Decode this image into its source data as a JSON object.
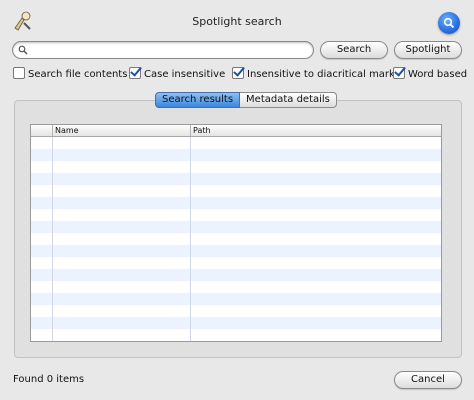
{
  "window": {
    "title": "Spotlight search"
  },
  "search": {
    "placeholder": "",
    "value": ""
  },
  "buttons": {
    "search": "Search",
    "spotlight": "Spotlight",
    "cancel": "Cancel"
  },
  "options": [
    {
      "label": "Search file contents",
      "checked": false
    },
    {
      "label": "Case insensitive",
      "checked": true
    },
    {
      "label": "Insensitive to diacritical marks",
      "checked": true
    },
    {
      "label": "Word based",
      "checked": true
    }
  ],
  "tabs": [
    {
      "label": "Search results",
      "active": true
    },
    {
      "label": "Metadata details",
      "active": false
    }
  ],
  "table": {
    "columns": [
      "Name",
      "Path"
    ],
    "rows": []
  },
  "status": {
    "text": "Found 0 items"
  },
  "colors": {
    "accent": "#3b86dd",
    "row_alt": "#edf3fe"
  },
  "icons": [
    "app-icon",
    "spotlight-icon",
    "search-icon"
  ]
}
